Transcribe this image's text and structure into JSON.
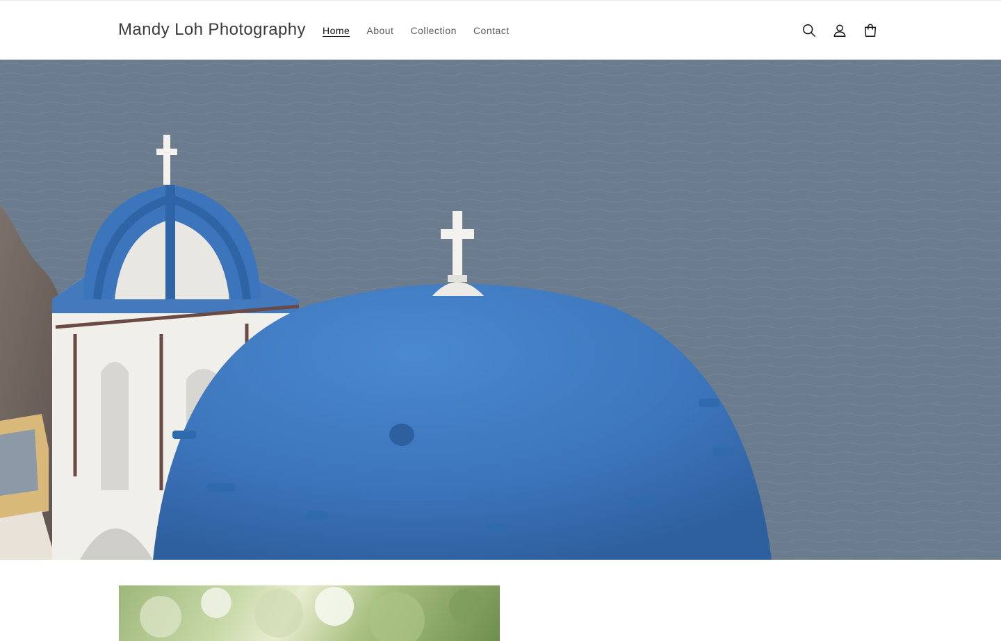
{
  "header": {
    "logo": "Mandy Loh Photography",
    "nav": [
      {
        "label": "Home",
        "active": true
      },
      {
        "label": "About",
        "active": false
      },
      {
        "label": "Collection",
        "active": false
      },
      {
        "label": "Contact",
        "active": false
      }
    ],
    "icons": [
      "search-icon",
      "account-icon",
      "cart-icon"
    ]
  },
  "hero": {
    "image": "blue-domed-church-over-sea"
  },
  "featured": {
    "image": "green-bokeh-foliage"
  },
  "colors": {
    "text": "#121212",
    "nav_text": "#5a5a5a",
    "dome_blue": "#3b74bd",
    "sea": "#65788a"
  }
}
